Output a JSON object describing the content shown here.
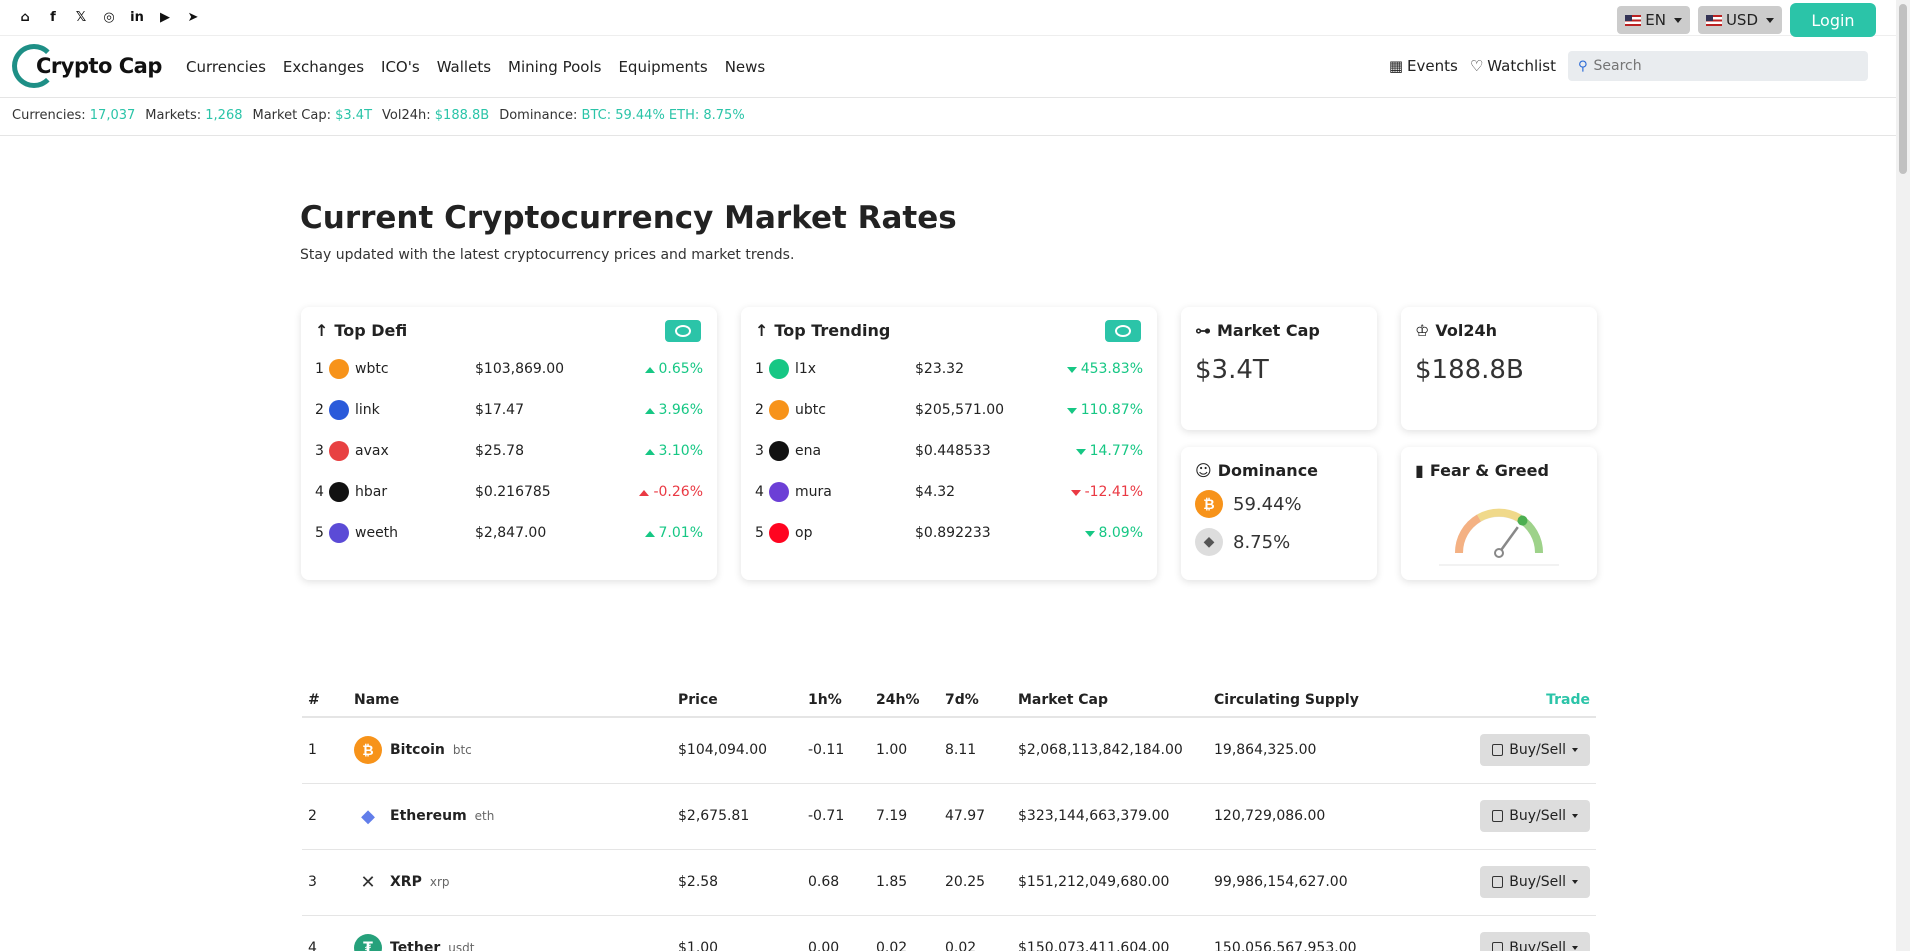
{
  "header": {
    "social_icons": [
      "home-icon",
      "facebook-icon",
      "x-icon",
      "instagram-icon",
      "linkedin-icon",
      "youtube-icon",
      "telegram-icon"
    ],
    "language": "EN",
    "currency": "USD",
    "login_label": "Login"
  },
  "nav": {
    "logo_text": "Crypto Cap",
    "menu": [
      "Currencies",
      "Exchanges",
      "ICO's",
      "Wallets",
      "Mining Pools",
      "Equipments",
      "News"
    ],
    "events_label": "Events",
    "watchlist_label": "Watchlist",
    "search_placeholder": "Search"
  },
  "stats": {
    "currencies_label": "Currencies:",
    "currencies_value": "17,037",
    "markets_label": "Markets:",
    "markets_value": "1,268",
    "marketcap_label": "Market Cap:",
    "marketcap_value": "$3.4T",
    "vol_label": "Vol24h:",
    "vol_value": "$188.8B",
    "dominance_label": "Dominance:",
    "dominance_value": "BTC: 59.44% ETH: 8.75%"
  },
  "page": {
    "title": "Current Cryptocurrency Market Rates",
    "subtitle": "Stay updated with the latest cryptocurrency prices and market trends."
  },
  "top_defi": {
    "title": "Top Defi",
    "rows": [
      {
        "rank": "1",
        "name": "wbtc",
        "price": "$103,869.00",
        "change": "0.65%",
        "dir": "up",
        "color": "#f7931a"
      },
      {
        "rank": "2",
        "name": "link",
        "price": "$17.47",
        "change": "3.96%",
        "dir": "up",
        "color": "#2a5ada"
      },
      {
        "rank": "3",
        "name": "avax",
        "price": "$25.78",
        "change": "3.10%",
        "dir": "up",
        "color": "#e84142"
      },
      {
        "rank": "4",
        "name": "hbar",
        "price": "$0.216785",
        "change": "-0.26%",
        "dir": "up-red",
        "color": "#111111"
      },
      {
        "rank": "5",
        "name": "weeth",
        "price": "$2,847.00",
        "change": "7.01%",
        "dir": "up",
        "color": "#5b4bd6"
      }
    ]
  },
  "top_trending": {
    "title": "Top Trending",
    "rows": [
      {
        "rank": "1",
        "name": "l1x",
        "price": "$23.32",
        "change": "453.83%",
        "dir": "down",
        "color": "#16c784"
      },
      {
        "rank": "2",
        "name": "ubtc",
        "price": "$205,571.00",
        "change": "110.87%",
        "dir": "down",
        "color": "#f7931a"
      },
      {
        "rank": "3",
        "name": "ena",
        "price": "$0.448533",
        "change": "14.77%",
        "dir": "down",
        "color": "#111111"
      },
      {
        "rank": "4",
        "name": "mura",
        "price": "$4.32",
        "change": "-12.41%",
        "dir": "down-red",
        "color": "#6c3fd6"
      },
      {
        "rank": "5",
        "name": "op",
        "price": "$0.892233",
        "change": "8.09%",
        "dir": "down",
        "color": "#ff0420"
      }
    ]
  },
  "market_cap": {
    "title": "Market Cap",
    "value": "$3.4T"
  },
  "vol24h": {
    "title": "Vol24h",
    "value": "$188.8B"
  },
  "dominance": {
    "title": "Dominance",
    "btc": "59.44%",
    "eth": "8.75%"
  },
  "fear_greed": {
    "title": "Fear & Greed",
    "value": 70
  },
  "table": {
    "headers": [
      "#",
      "Name",
      "Price",
      "1h%",
      "24h%",
      "7d%",
      "Market Cap",
      "Circulating Supply",
      "Trade"
    ],
    "buy_label": "Buy/Sell",
    "rows": [
      {
        "rank": "1",
        "name": "Bitcoin",
        "symbol": "btc",
        "price": "$104,094.00",
        "h1": "-0.11",
        "h1c": "dn",
        "h24": "1.00",
        "h24c": "up",
        "d7": "8.11",
        "d7c": "up",
        "mcap": "$2,068,113,842,184.00",
        "supply": "19,864,325.00",
        "color": "#f7931a",
        "glyph": "₿"
      },
      {
        "rank": "2",
        "name": "Ethereum",
        "symbol": "eth",
        "price": "$2,675.81",
        "h1": "-0.71",
        "h1c": "dn",
        "h24": "7.19",
        "h24c": "up",
        "d7": "47.97",
        "d7c": "up",
        "mcap": "$323,144,663,379.00",
        "supply": "120,729,086.00",
        "color": "#627eea",
        "glyph": "◆"
      },
      {
        "rank": "3",
        "name": "XRP",
        "symbol": "xrp",
        "price": "$2.58",
        "h1": "0.68",
        "h1c": "up",
        "h24": "1.85",
        "h24c": "up",
        "d7": "20.25",
        "d7c": "up",
        "mcap": "$151,212,049,680.00",
        "supply": "99,986,154,627.00",
        "color": "#ffffff",
        "glyph": "✕"
      },
      {
        "rank": "4",
        "name": "Tether",
        "symbol": "usdt",
        "price": "$1.00",
        "h1": "0.00",
        "h1c": "dn",
        "h24": "0.02",
        "h24c": "up",
        "d7": "0.02",
        "d7c": "up",
        "mcap": "$150,073,411,604.00",
        "supply": "150,056,567,953.00",
        "color": "#26a17b",
        "glyph": "₮"
      }
    ]
  }
}
